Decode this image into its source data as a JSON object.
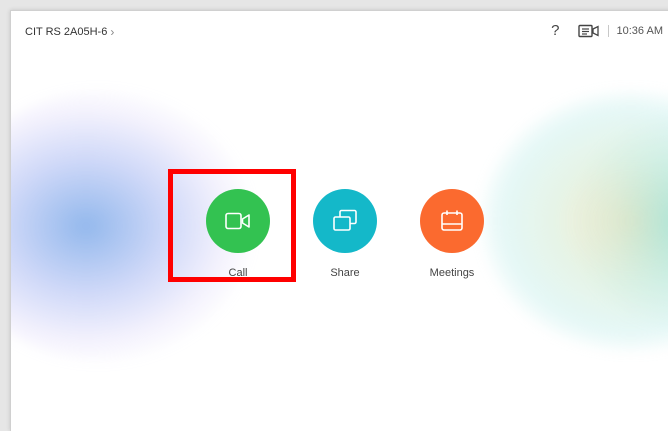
{
  "header": {
    "device_name": "CIT RS 2A05H-6",
    "chevron": "›",
    "help": "?",
    "time": "10:36 AM"
  },
  "actions": [
    {
      "id": "call",
      "label": "Call",
      "color": "#33c251",
      "icon": "video-camera-icon"
    },
    {
      "id": "share",
      "label": "Share",
      "color": "#14b8c9",
      "icon": "screen-share-icon"
    },
    {
      "id": "meetings",
      "label": "Meetings",
      "color": "#fb6a2f",
      "icon": "calendar-icon"
    }
  ],
  "highlight_color": "#ff0000"
}
